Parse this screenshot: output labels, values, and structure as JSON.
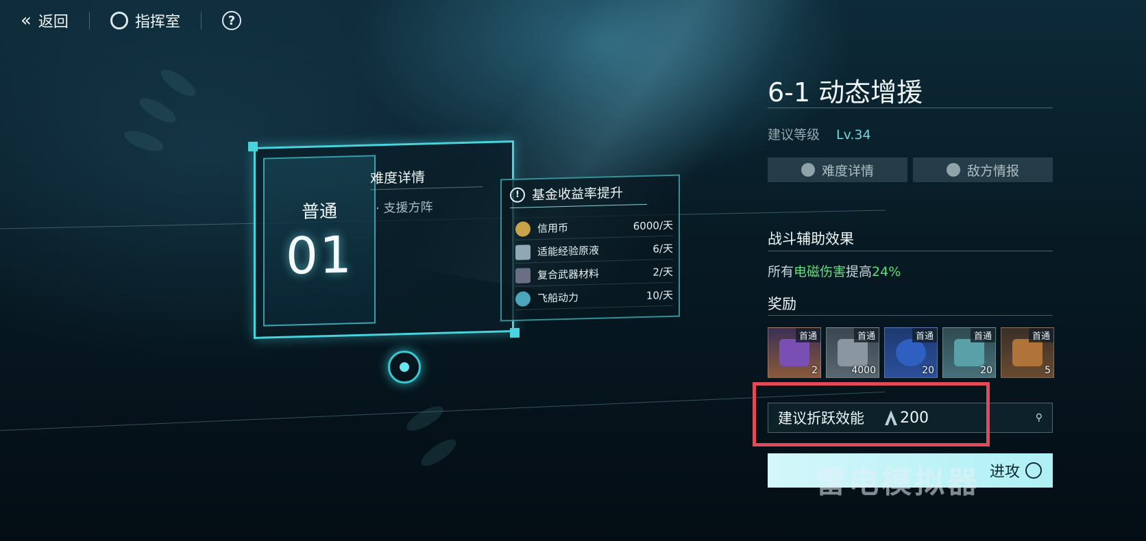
{
  "topbar": {
    "back": "返回",
    "command_room": "指挥室",
    "help": "?"
  },
  "card": {
    "mode": "普通",
    "number": "01",
    "difficulty_title": "难度详情",
    "difficulty_item": "支援方阵"
  },
  "fund": {
    "title": "基金收益率提升",
    "rows": [
      {
        "name": "信用币",
        "rate": "6000/天"
      },
      {
        "name": "适能经验原液",
        "rate": "6/天"
      },
      {
        "name": "复合武器材料",
        "rate": "2/天"
      },
      {
        "name": "飞船动力",
        "rate": "10/天"
      }
    ]
  },
  "stage": {
    "title": "6-1 动态增援",
    "level_label": "建议等级",
    "level_value": "Lv.34",
    "btn_difficulty": "难度详情",
    "btn_enemy": "敌方情报",
    "effect_title": "战斗辅助效果",
    "effect_prefix": "所有",
    "effect_highlight": "电磁伤害",
    "effect_mid": "提高",
    "effect_value": "24%",
    "rewards_title": "奖励",
    "rewards": [
      {
        "tag": "首通",
        "count": "2",
        "icon": "purple-card-icon",
        "color": "#7a4fb3"
      },
      {
        "tag": "首通",
        "count": "4000",
        "icon": "exp-icon",
        "color": "#8a96a0"
      },
      {
        "tag": "首通",
        "count": "20",
        "icon": "blue-chip-icon",
        "color": "#2f5fc0"
      },
      {
        "tag": "首通",
        "count": "20",
        "icon": "green-battery-box-icon",
        "color": "#5aa0a8"
      },
      {
        "tag": "首通",
        "count": "5",
        "icon": "weapon-material-icon",
        "color": "#b0733a"
      }
    ],
    "power_label": "建议折跃效能",
    "power_value": "200",
    "attack": "进攻"
  },
  "watermark": "雷电模拟器",
  "colors": {
    "accent": "#49d3dc",
    "highlight_box": "#e24a5a",
    "effect_green": "#5de07a"
  }
}
